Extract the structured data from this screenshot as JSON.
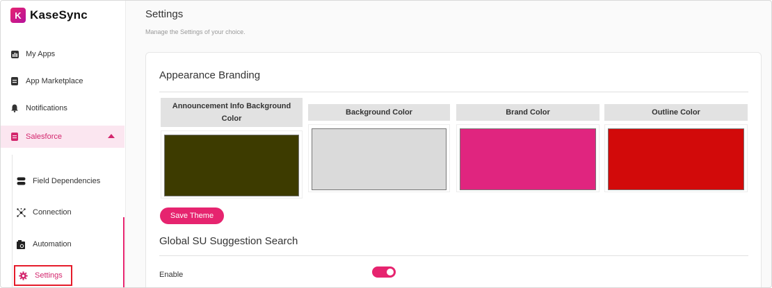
{
  "app": {
    "name": "KaseSync",
    "logo_glyph": "K",
    "accent": "#e6246f"
  },
  "sidebar": {
    "items": [
      {
        "label": "My Apps",
        "icon": "bar-chart-icon"
      },
      {
        "label": "App Marketplace",
        "icon": "document-icon"
      },
      {
        "label": "Notifications",
        "icon": "bell-icon"
      },
      {
        "label": "Salesforce",
        "icon": "document-icon",
        "expanded": true
      }
    ],
    "sub_items": [
      {
        "label": "Field Dependencies",
        "icon": "toggle-icon"
      },
      {
        "label": "Connection",
        "icon": "network-icon"
      },
      {
        "label": "Automation",
        "icon": "automation-icon"
      },
      {
        "label": "Settings",
        "icon": "gear-icon",
        "selected": true
      }
    ]
  },
  "page": {
    "title": "Settings",
    "subtitle": "Manage the Settings of your choice."
  },
  "appearance": {
    "title": "Appearance Branding",
    "columns": [
      {
        "label": "Announcement Info Background Color",
        "color": "#3d3b00"
      },
      {
        "label": "Background Color",
        "color": "#dadada"
      },
      {
        "label": "Brand Color",
        "color": "#e0257f"
      },
      {
        "label": "Outline Color",
        "color": "#d20a0a"
      }
    ],
    "save_label": "Save Theme"
  },
  "suggestion_search": {
    "title": "Global SU Suggestion Search",
    "enable_label": "Enable",
    "enabled": true
  }
}
